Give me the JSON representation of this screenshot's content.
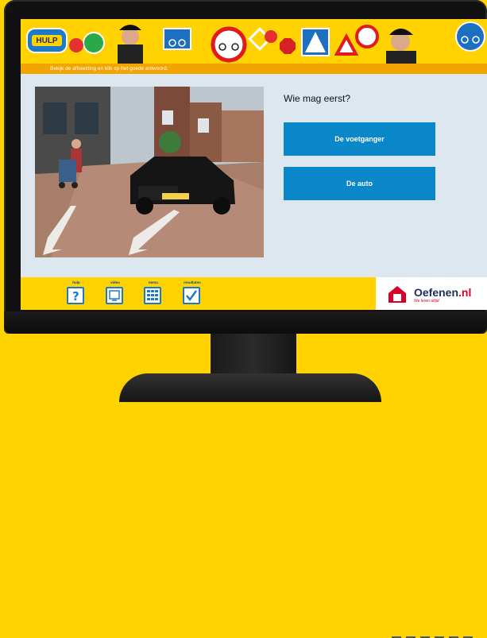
{
  "app": {
    "logo_text": "HULP",
    "instruction": "Bekijk de afbeelding en klik op het goede antwoord."
  },
  "quiz": {
    "question": "Wie mag eerst?",
    "answers": [
      "De voetganger",
      "De auto"
    ]
  },
  "photo": {
    "license_plate": "NV-XXX-X"
  },
  "toolbar": {
    "items": [
      {
        "label": "hulp",
        "icon": "question-icon"
      },
      {
        "label": "video",
        "icon": "video-icon"
      },
      {
        "label": "menu",
        "icon": "menu-grid-icon"
      },
      {
        "label": "resultaten",
        "icon": "checkmark-icon"
      }
    ]
  },
  "brand": {
    "name": "Oefenen",
    "tld": ".nl",
    "tagline": "We leren altijd",
    "colors": {
      "yellow": "#ffd200",
      "blue": "#0a87c9",
      "red": "#d6002a",
      "navy": "#1c2d5a"
    }
  }
}
